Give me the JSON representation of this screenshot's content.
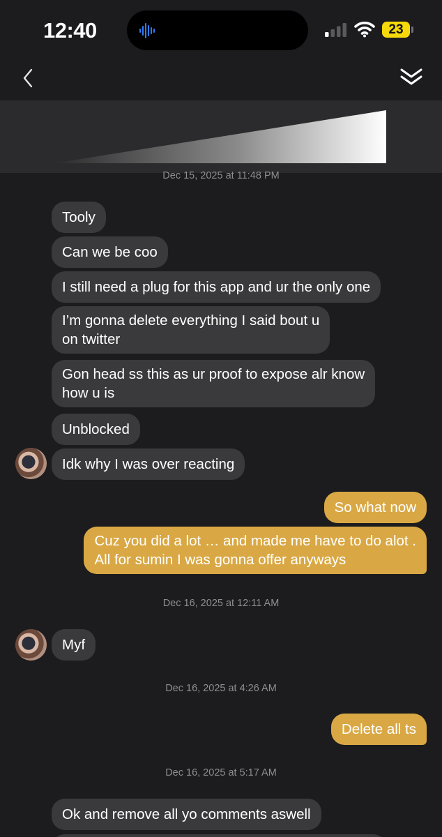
{
  "status_bar": {
    "time": "12:40",
    "battery_level": "23",
    "signal_bars_active": 1,
    "signal_bars_total": 4
  },
  "nav": {
    "back_icon": "chevron-left-icon",
    "collapse_icon": "double-chevron-down-icon"
  },
  "colors": {
    "background": "#1c1c1e",
    "incoming_bubble": "#3a3a3c",
    "outgoing_bubble": "#d9a844",
    "timestamp": "#8e8e93",
    "battery": "#f5d90a"
  },
  "conversation": {
    "timestamps": [
      "Dec 15, 2025 at 11:48 PM",
      "Dec 16, 2025 at 12:11 AM",
      "Dec 16, 2025 at 4:26 AM",
      "Dec 16, 2025 at 5:17 AM"
    ],
    "messages": [
      {
        "from": "them",
        "text": "Tooly"
      },
      {
        "from": "them",
        "text": "Can we be coo"
      },
      {
        "from": "them",
        "text": "I still need a plug for this app and ur the only one"
      },
      {
        "from": "them",
        "line1": "I’m gonna delete everything I said bout u",
        "line2": "on twitter"
      },
      {
        "from": "them",
        "line1": "Gon head ss this as ur proof to expose alr know",
        "line2": "how u is"
      },
      {
        "from": "them",
        "text": "Unblocked"
      },
      {
        "from": "them",
        "text": "Idk why I was over reacting"
      },
      {
        "from": "me",
        "text": "So what now"
      },
      {
        "from": "me",
        "line1": "Cuz you did a lot … and made me have to do alot .",
        "line2": "All for sumin I was gonna offer anyways"
      },
      {
        "from": "them",
        "text": "Myf"
      },
      {
        "from": "me",
        "text": "Delete all ts"
      },
      {
        "from": "them",
        "text": "Ok and remove all yo comments aswell"
      }
    ]
  }
}
